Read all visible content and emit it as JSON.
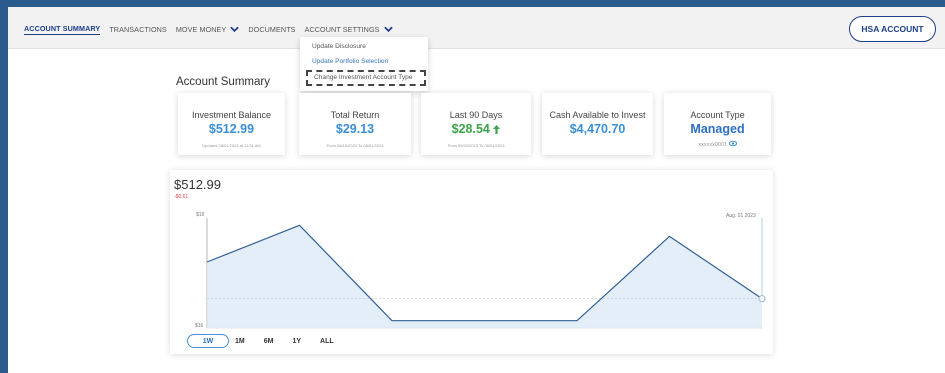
{
  "nav": {
    "items": [
      "ACCOUNT SUMMARY",
      "TRANSACTIONS",
      "MOVE MONEY",
      "DOCUMENTS",
      "ACCOUNT SETTINGS"
    ],
    "hsa_button": "HSA ACCOUNT"
  },
  "dropdown": {
    "items": [
      "Update Disclosure",
      "Update Portfolio Selection",
      "Change Investment Account Type"
    ]
  },
  "summary": {
    "title": "Account Summary",
    "cards": [
      {
        "label": "Investment Balance",
        "value": "$512.99",
        "note": "Updated 08/01/2023 at 11:51 AM"
      },
      {
        "label": "Total Return",
        "value": "$29.13",
        "note": "From 06/15/2023 To 08/01/2023"
      },
      {
        "label": "Last 90 Days",
        "value": "$28.54",
        "note": "From 05/03/2023 To 08/01/2023"
      },
      {
        "label": "Cash Available to Invest",
        "value": "$4,470.70",
        "note": ""
      },
      {
        "label": "Account Type",
        "value": "Managed",
        "note": "xxxxxx0001"
      }
    ]
  },
  "chart": {
    "balance": "$512.99",
    "change": "-$0.61",
    "y_top_label": "$19",
    "y_bottom_label": "$16",
    "date_label": "Aug. 01 2023",
    "ranges": [
      "1W",
      "1M",
      "6M",
      "1Y",
      "ALL"
    ],
    "active_range": "1W",
    "colors": {
      "line": "#2f5f95",
      "fill": "#dceaf8",
      "accent": "#3a8fd8"
    }
  },
  "chart_data": {
    "type": "area",
    "title": "",
    "series": [
      {
        "name": "",
        "values": [
          17.8,
          18.8,
          16.2,
          16.2,
          16.2,
          18.5,
          16.8
        ]
      }
    ],
    "ylim": [
      16,
      19
    ],
    "grid": false
  }
}
